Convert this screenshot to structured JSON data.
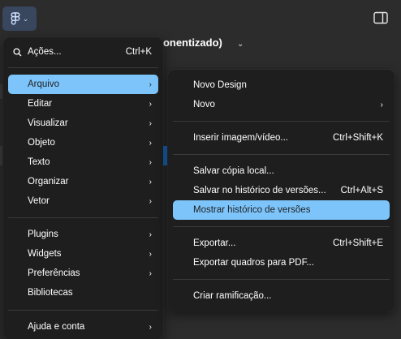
{
  "toolbar": {
    "file_title_partial": "ponentizado)",
    "logo_icon": "figma-logo-icon",
    "panel_icon": "sidebar-panel-icon"
  },
  "main_menu": {
    "search": {
      "label": "Ações...",
      "shortcut": "Ctrl+K",
      "icon": "search-icon"
    },
    "group1": [
      {
        "label": "Arquivo",
        "submenu": true,
        "active": true
      },
      {
        "label": "Editar",
        "submenu": true
      },
      {
        "label": "Visualizar",
        "submenu": true
      },
      {
        "label": "Objeto",
        "submenu": true
      },
      {
        "label": "Texto",
        "submenu": true
      },
      {
        "label": "Organizar",
        "submenu": true
      },
      {
        "label": "Vetor",
        "submenu": true
      }
    ],
    "group2": [
      {
        "label": "Plugins",
        "submenu": true
      },
      {
        "label": "Widgets",
        "submenu": true
      },
      {
        "label": "Preferências",
        "submenu": true
      },
      {
        "label": "Bibliotecas",
        "submenu": false
      }
    ],
    "group3": [
      {
        "label": "Ajuda e conta",
        "submenu": true
      }
    ]
  },
  "file_submenu": {
    "group1": [
      {
        "label": "Novo Design",
        "shortcut": ""
      },
      {
        "label": "Novo",
        "submenu": true
      }
    ],
    "group2": [
      {
        "label": "Inserir imagem/vídeo...",
        "shortcut": "Ctrl+Shift+K"
      }
    ],
    "group3": [
      {
        "label": "Salvar cópia local...",
        "shortcut": ""
      },
      {
        "label": "Salvar no histórico de versões...",
        "shortcut": "Ctrl+Alt+S"
      },
      {
        "label": "Mostrar histórico de versões",
        "shortcut": "",
        "hovered": true
      }
    ],
    "group4": [
      {
        "label": "Exportar...",
        "shortcut": "Ctrl+Shift+E"
      },
      {
        "label": "Exportar quadros para PDF...",
        "shortcut": ""
      }
    ],
    "group5": [
      {
        "label": "Criar ramificação...",
        "shortcut": ""
      }
    ]
  },
  "colors": {
    "menu_bg": "#1e1e1e",
    "highlight": "#7cc4fa",
    "logo_button_bg": "#38465e"
  }
}
